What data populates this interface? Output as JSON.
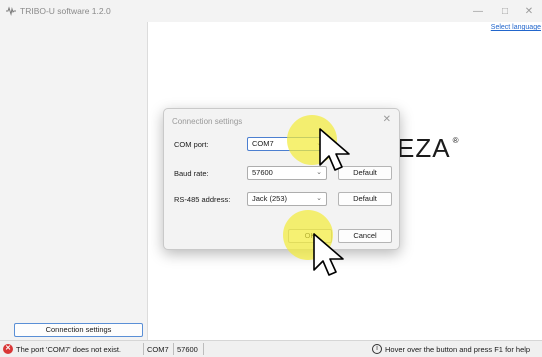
{
  "window": {
    "title": "TRIBO-U software 1.2.0",
    "app_icon": "waveform-icon",
    "controls": [
      "minimize-icon",
      "maximize-icon",
      "close-icon"
    ]
  },
  "main": {
    "select_language": "Select language",
    "logo_text": "EZA",
    "logo_mark": "®"
  },
  "sidebar": {
    "connection_settings_label": "Connection settings"
  },
  "dialog": {
    "title": "Connection settings",
    "close_icon": "close-icon",
    "com_port": {
      "label": "COM port:",
      "value": "COM7"
    },
    "baud_rate": {
      "label": "Baud rate:",
      "value": "57600",
      "default_label": "Default"
    },
    "rs485": {
      "label": "RS-485 address:",
      "value": "Jack (253)",
      "default_label": "Default"
    },
    "ok_label": "OK",
    "cancel_label": "Cancel"
  },
  "statusbar": {
    "error_icon": "error-icon",
    "message": "The port 'COM7' does not exist.",
    "port": "COM7",
    "baud": "57600",
    "hint_icon": "info-icon",
    "hint": "Hover over the button and press F1 for help"
  },
  "colors": {
    "accent": "#2266cc",
    "error": "#d93636",
    "cursor_highlight": "#f2ec3c"
  }
}
